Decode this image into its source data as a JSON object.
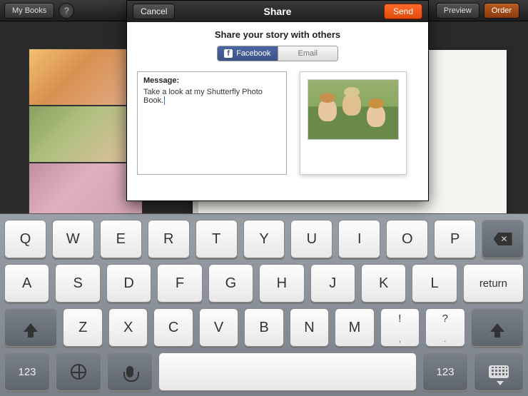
{
  "topbar": {
    "my_books": "My Books",
    "help": "?",
    "preview": "Preview",
    "order": "Order"
  },
  "modal": {
    "title": "Share",
    "cancel": "Cancel",
    "send": "Send",
    "subtitle": "Share your story with others",
    "tabs": {
      "facebook": "Facebook",
      "email": "Email"
    },
    "message_label": "Message:",
    "message_text": "Take a look at my Shutterfly Photo Book."
  },
  "keyboard": {
    "row1": [
      "Q",
      "W",
      "E",
      "R",
      "T",
      "Y",
      "U",
      "I",
      "O",
      "P"
    ],
    "row2": [
      "A",
      "S",
      "D",
      "F",
      "G",
      "H",
      "J",
      "K",
      "L"
    ],
    "row3": [
      "Z",
      "X",
      "C",
      "V",
      "B",
      "N",
      "M"
    ],
    "punct1_top": "!",
    "punct1_bottom": ",",
    "punct2_top": "?",
    "punct2_bottom": ".",
    "return": "return",
    "numkey": "123",
    "backspace_glyph": "✕"
  }
}
